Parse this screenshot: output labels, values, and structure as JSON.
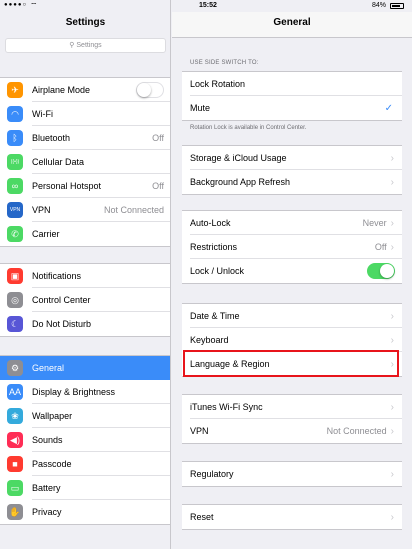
{
  "left": {
    "statusbar": {
      "dots": "●●●●○",
      "wifi": "⌔"
    },
    "title": "Settings",
    "search_placeholder": "Settings",
    "groups": [
      [
        {
          "name": "airplane",
          "label": "Airplane Mode",
          "icon": "airplane-icon",
          "glyph": "✈",
          "color": "#ff9500",
          "toggle": true
        },
        {
          "name": "wifi",
          "label": "Wi-Fi",
          "icon": "wifi-icon",
          "glyph": "◠",
          "color": "#3a8cf9",
          "value": "    "
        },
        {
          "name": "bluetooth",
          "label": "Bluetooth",
          "icon": "bluetooth-icon",
          "glyph": "ᛒ",
          "color": "#3a8cf9",
          "value": "Off"
        },
        {
          "name": "cellular-data",
          "label": "Cellular Data",
          "icon": "cellular-icon",
          "glyph": "((•))",
          "color": "#4cd964"
        },
        {
          "name": "personal-hotspot",
          "label": "Personal Hotspot",
          "icon": "hotspot-icon",
          "glyph": "∞",
          "color": "#4cd964",
          "value": "Off"
        },
        {
          "name": "vpn",
          "label": "VPN",
          "icon": "vpn-icon",
          "glyph": "VPN",
          "color": "#2567c8",
          "value": "Not Connected"
        },
        {
          "name": "carrier",
          "label": "Carrier",
          "icon": "phone-icon",
          "glyph": "✆",
          "color": "#4cd964",
          "value": "    "
        }
      ],
      [
        {
          "name": "notifications",
          "label": "Notifications",
          "icon": "notifications-icon",
          "glyph": "▣",
          "color": "#ff3b30"
        },
        {
          "name": "control-center",
          "label": "Control Center",
          "icon": "control-center-icon",
          "glyph": "◎",
          "color": "#8e8e93"
        },
        {
          "name": "do-not-disturb",
          "label": "Do Not Disturb",
          "icon": "moon-icon",
          "glyph": "☾",
          "color": "#5856d6"
        }
      ],
      [
        {
          "name": "general",
          "label": "General",
          "icon": "gear-icon",
          "glyph": "⚙",
          "color": "#8e8e93",
          "selected": true
        },
        {
          "name": "display-brightness",
          "label": "Display & Brightness",
          "icon": "display-icon",
          "glyph": "AA",
          "color": "#3a8cf9"
        },
        {
          "name": "wallpaper",
          "label": "Wallpaper",
          "icon": "wallpaper-icon",
          "glyph": "❀",
          "color": "#34aadc"
        },
        {
          "name": "sounds",
          "label": "Sounds",
          "icon": "sounds-icon",
          "glyph": "◀)",
          "color": "#ff2d55"
        },
        {
          "name": "passcode",
          "label": "Passcode",
          "icon": "lock-icon",
          "glyph": "■",
          "color": "#ff3b30"
        },
        {
          "name": "battery",
          "label": "Battery",
          "icon": "battery-icon",
          "glyph": "▭",
          "color": "#4cd964"
        },
        {
          "name": "privacy",
          "label": "Privacy",
          "icon": "hand-icon",
          "glyph": "✋",
          "color": "#8e8e93"
        }
      ]
    ]
  },
  "right": {
    "statusbar": {
      "time": "15:52",
      "battery": "84%",
      "battery_level": 0.84
    },
    "title": "General",
    "side_switch_header": "USE SIDE SWITCH TO:",
    "side_switch_footer": "Rotation Lock is available in Control Center.",
    "groups": [
      [
        {
          "name": "lock-rotation",
          "label": "Lock Rotation"
        },
        {
          "name": "mute",
          "label": "Mute",
          "check": "✓"
        }
      ],
      [
        {
          "name": "storage-icloud-usage",
          "label": "Storage & iCloud Usage",
          "chev": "›"
        },
        {
          "name": "background-app-refresh",
          "label": "Background App Refresh",
          "chev": "›"
        }
      ],
      [
        {
          "name": "auto-lock",
          "label": "Auto-Lock",
          "value": "Never",
          "chev": "›"
        },
        {
          "name": "restrictions",
          "label": "Restrictions",
          "value": "Off",
          "chev": "›"
        },
        {
          "name": "lock-unlock",
          "label": "Lock / Unlock",
          "toggle_on": true
        }
      ],
      [
        {
          "name": "date-time",
          "label": "Date & Time",
          "chev": "›"
        },
        {
          "name": "keyboard",
          "label": "Keyboard",
          "chev": "›"
        },
        {
          "name": "language-region",
          "label": "Language & Region",
          "chev": "›"
        }
      ],
      [
        {
          "name": "itunes-wifi-sync",
          "label": "iTunes Wi-Fi Sync",
          "chev": "›"
        },
        {
          "name": "vpn",
          "label": "VPN",
          "value": "Not Connected",
          "chev": "›"
        }
      ],
      [
        {
          "name": "regulatory",
          "label": "Regulatory",
          "chev": "›"
        }
      ],
      [
        {
          "name": "reset",
          "label": "Reset",
          "chev": "›"
        }
      ]
    ]
  }
}
